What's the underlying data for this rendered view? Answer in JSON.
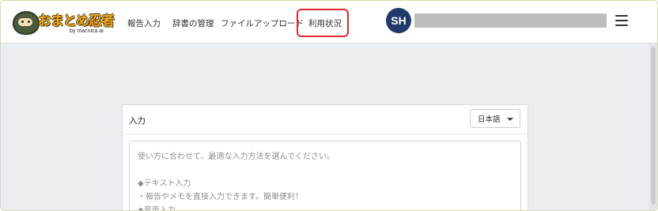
{
  "header": {
    "logo": {
      "title": "おまとめ忍者",
      "sub": "by macnica.ai",
      "mascot_icon": "ninja-mascot-icon"
    },
    "nav": [
      {
        "label": "報告入力"
      },
      {
        "label": "辞書の管理"
      },
      {
        "label": "ファイルアップロード"
      },
      {
        "label": "利用状況"
      }
    ],
    "highlighted_nav": "利用状況",
    "user": {
      "initials": "SH",
      "name_redacted": true
    },
    "menu_icon": "hamburger-menu-icon"
  },
  "input_card": {
    "label": "入力",
    "language": {
      "selected": "日本語"
    },
    "textarea": {
      "placeholder": "使い方に合わせて、最適な入力方法を選んでください。\n\n◆テキスト入力\n・報告やメモを直接入力できます。簡単便利！\n◆音声入力"
    }
  },
  "colors": {
    "page_bg": "#ebeef1",
    "avatar_bg": "#1f3a6b",
    "highlight": "#e0282e",
    "logo_orange": "#f0a81e"
  }
}
